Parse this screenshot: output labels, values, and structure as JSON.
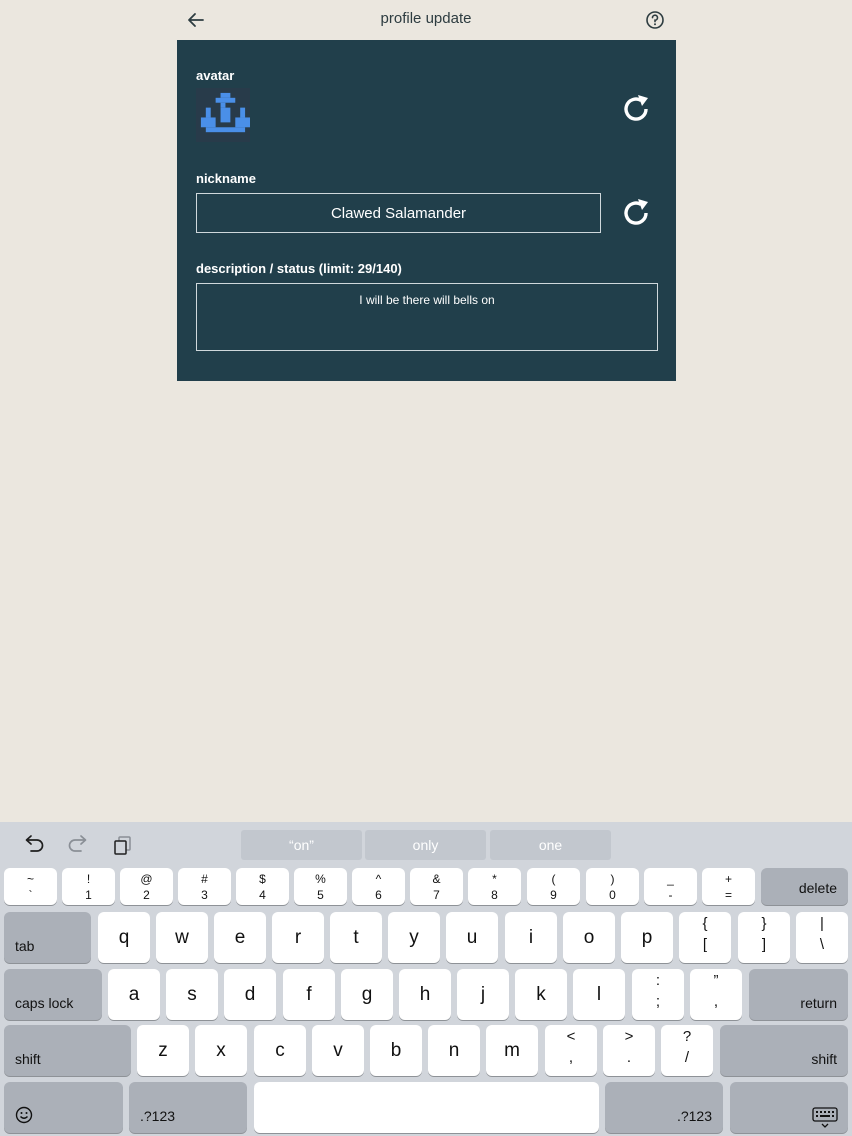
{
  "header": {
    "title": "profile update"
  },
  "card": {
    "avatar_label": "avatar",
    "nickname_label": "nickname",
    "nickname_value": "Clawed Salamander",
    "description_label": "description / status (limit: 29/140)",
    "description_value": "I will be there will bells on"
  },
  "colors": {
    "background": "#ebe7df",
    "card": "#213f4b",
    "avatar_fill": "#4a8fe8"
  },
  "keyboard": {
    "suggestions": [
      "“on”",
      "only",
      "one"
    ],
    "row1": [
      {
        "top": "~",
        "bottom": "`"
      },
      {
        "top": "!",
        "bottom": "1"
      },
      {
        "top": "@",
        "bottom": "2"
      },
      {
        "top": "#",
        "bottom": "3"
      },
      {
        "top": "$",
        "bottom": "4"
      },
      {
        "top": "%",
        "bottom": "5"
      },
      {
        "top": "^",
        "bottom": "6"
      },
      {
        "top": "&",
        "bottom": "7"
      },
      {
        "top": "*",
        "bottom": "8"
      },
      {
        "top": "(",
        "bottom": "9"
      },
      {
        "top": ")",
        "bottom": "0"
      },
      {
        "top": "_",
        "bottom": "-"
      },
      {
        "top": "+",
        "bottom": "="
      }
    ],
    "delete": "delete",
    "tab": "tab",
    "row2": [
      "q",
      "w",
      "e",
      "r",
      "t",
      "y",
      "u",
      "i",
      "o",
      "p"
    ],
    "row2_symbols": [
      {
        "top": "{",
        "bottom": "["
      },
      {
        "top": "}",
        "bottom": "]"
      },
      {
        "top": "|",
        "bottom": "\\"
      }
    ],
    "caps_lock": "caps lock",
    "row3": [
      "a",
      "s",
      "d",
      "f",
      "g",
      "h",
      "j",
      "k",
      "l"
    ],
    "row3_symbols": [
      {
        "top": ":",
        "bottom": ";"
      },
      {
        "top": "”",
        "bottom": ","
      }
    ],
    "return": "return",
    "shift_left": "shift",
    "row4": [
      "z",
      "x",
      "c",
      "v",
      "b",
      "n",
      "m"
    ],
    "row4_symbols": [
      {
        "top": "<",
        "bottom": ","
      },
      {
        "top": ">",
        "bottom": "."
      },
      {
        "top": "?",
        "bottom": "/"
      }
    ],
    "shift_right": "shift",
    "numbers_left": ".?123",
    "numbers_right": ".?123"
  }
}
